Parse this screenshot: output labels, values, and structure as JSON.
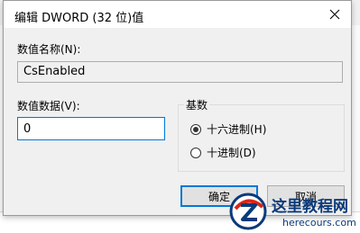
{
  "dialog": {
    "title": "编辑 DWORD (32 位)值",
    "value_name_label": "数值名称(N):",
    "value_name": "CsEnabled",
    "value_data_label": "数值数据(V):",
    "value_data": "0",
    "base_label": "基数",
    "base_options": [
      "十六进制(H)",
      "十进制(D)"
    ],
    "base_selected": "十六进制(H)",
    "ok_label": "确定",
    "cancel_label": "取消"
  },
  "watermark": {
    "title": "这里教程网",
    "site": "herecours.com"
  }
}
